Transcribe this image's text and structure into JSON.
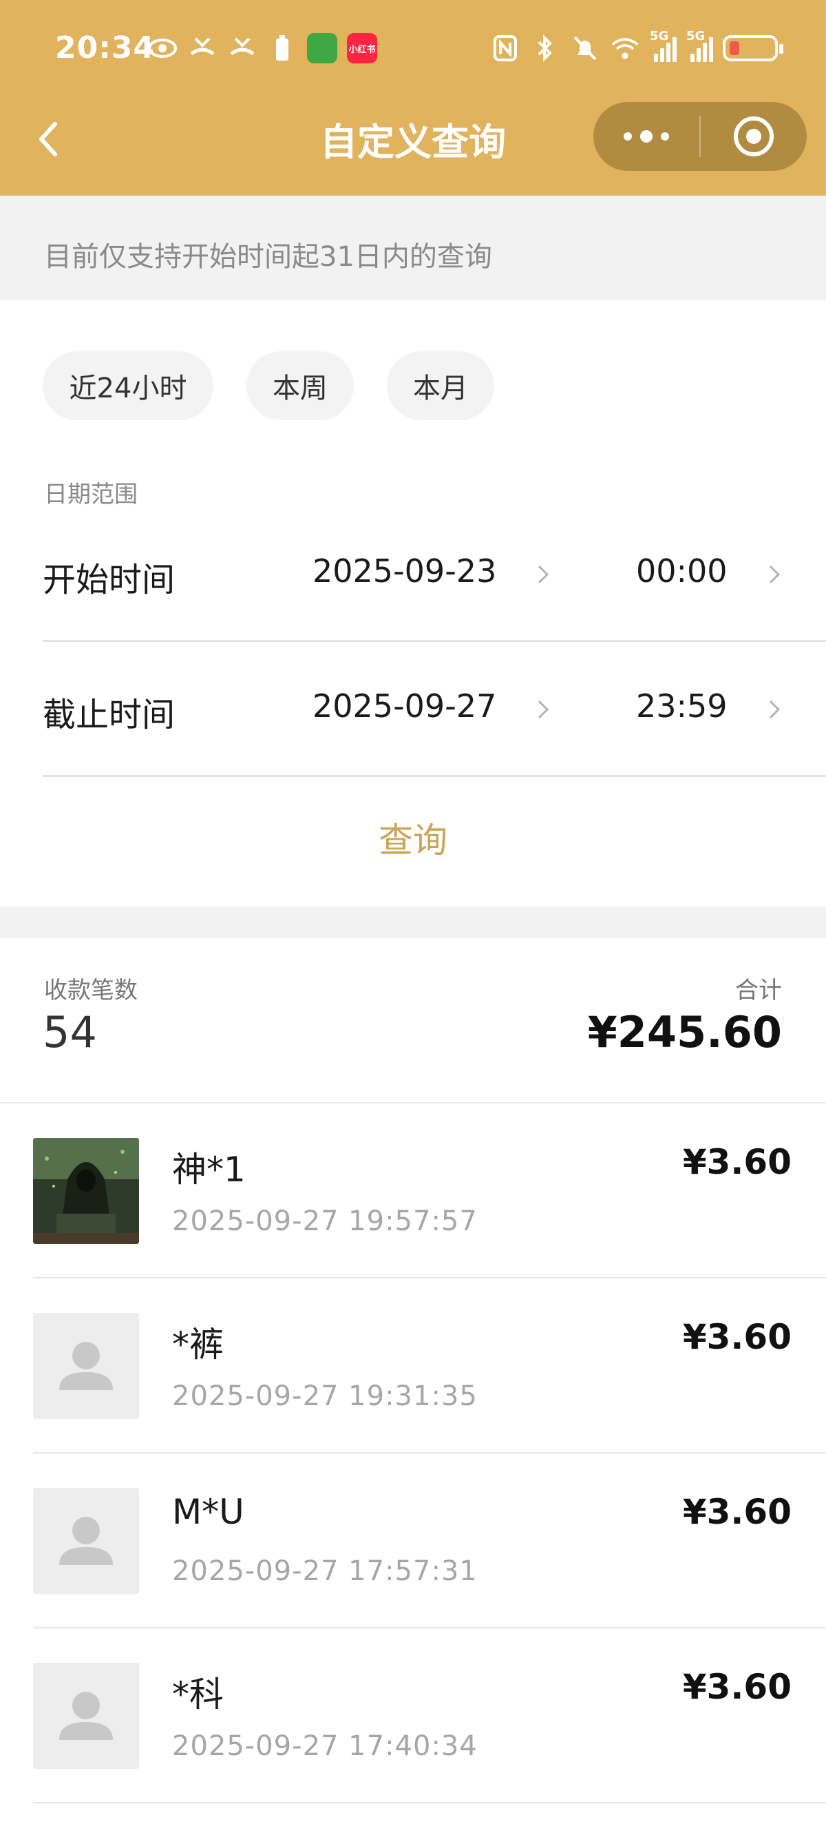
{
  "status_bar": {
    "time": "20:34",
    "app_badge_text": "小红书",
    "network_label_1": "5G",
    "network_label_2": "5G",
    "battery_color": "#f05a4a"
  },
  "nav": {
    "title": "自定义查询",
    "background": "#e0b35c"
  },
  "notice": "目前仅支持开始时间起31日内的查询",
  "quick_ranges": [
    "近24小时",
    "本周",
    "本月"
  ],
  "date_range": {
    "label": "日期范围",
    "start": {
      "label": "开始时间",
      "date": "2025-09-23",
      "time": "00:00"
    },
    "end": {
      "label": "截止时间",
      "date": "2025-09-27",
      "time": "23:59"
    }
  },
  "query_button": "查询",
  "summary": {
    "count_label": "收款笔数",
    "count": "54",
    "total_label": "合计",
    "total": "¥245.60"
  },
  "records": [
    {
      "name": "神*1",
      "time": "2025-09-27 19:57:57",
      "amount": "¥3.60",
      "avatar": "photo-avatar"
    },
    {
      "name": "*裤",
      "time": "2025-09-27 19:31:35",
      "amount": "¥3.60",
      "avatar": "default-avatar"
    },
    {
      "name": "M*U",
      "time": "2025-09-27 17:57:31",
      "amount": "¥3.60",
      "avatar": "default-avatar"
    },
    {
      "name": "*科",
      "time": "2025-09-27 17:40:34",
      "amount": "¥3.60",
      "avatar": "default-avatar"
    }
  ]
}
